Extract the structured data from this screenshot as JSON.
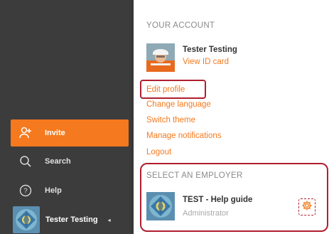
{
  "sidebar": {
    "items": [
      {
        "id": "invite",
        "label": "Invite",
        "icon": "add-person-icon"
      },
      {
        "id": "search",
        "label": "Search",
        "icon": "search-icon"
      },
      {
        "id": "help",
        "label": "Help",
        "icon": "help-icon"
      }
    ],
    "user": {
      "name": "Tester Testing",
      "caret": "◂"
    }
  },
  "account": {
    "title": "YOUR ACCOUNT",
    "name": "Tester Testing",
    "view_id_label": "View ID card",
    "links": {
      "edit_profile": "Edit profile",
      "change_language": "Change language",
      "switch_theme": "Switch theme",
      "manage_notifications": "Manage notifications",
      "logout": "Logout"
    }
  },
  "employer": {
    "title": "SELECT AN EMPLOYER",
    "name": "TEST - Help guide",
    "role": "Administrator",
    "settings_icon": "gear-icon"
  },
  "colors": {
    "accent": "#f5791e",
    "sidebar_bg": "#3c3c3c",
    "highlight": "#b01e2f"
  }
}
